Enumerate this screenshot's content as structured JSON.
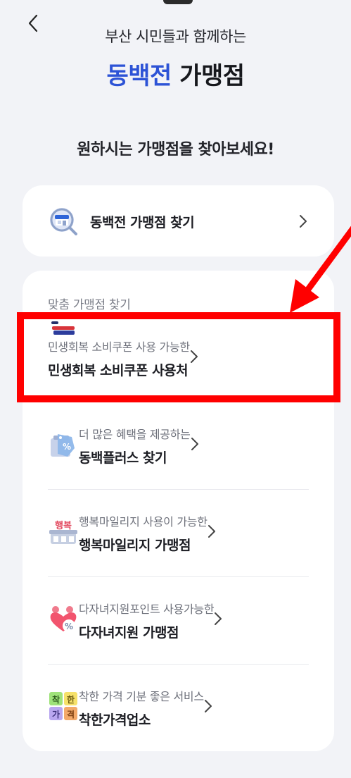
{
  "header": {
    "subtitle": "부산 시민들과 함께하는",
    "title_accent": "동백전",
    "title_plain": "가맹점"
  },
  "prompt": "원하시는 가맹점을 찾아보세요!",
  "find_card": {
    "label": "동백전 가맹점 찾기",
    "icon": "store-search-icon"
  },
  "list_card": {
    "section_label": "맞춤 가맹점 찾기",
    "items": [
      {
        "sub": "민생회복 소비쿠폰 사용 가능한",
        "main": "민생회복 소비쿠폰 사용처",
        "icon": "coupon-logo-icon"
      },
      {
        "sub": "더 많은 혜택을 제공하는",
        "main": "동백플러스 찾기",
        "icon": "discount-tag-icon"
      },
      {
        "sub": "행복마일리지 사용이 가능한",
        "main": "행복마일리지 가맹점",
        "icon": "happiness-store-icon",
        "icon_text": "행복"
      },
      {
        "sub": "다자녀지원포인트 사용가능한",
        "main": "다자녀지원 가맹점",
        "icon": "family-heart-icon"
      },
      {
        "sub": "착한 가격 기분 좋은 서비스",
        "main": "착한가격업소",
        "icon": "good-price-icon",
        "icon_chars": [
          "착",
          "한",
          "가",
          "격"
        ]
      }
    ]
  },
  "colors": {
    "accent": "#2d53d6",
    "background": "#f2f3f7",
    "highlight": "#ff0000"
  }
}
